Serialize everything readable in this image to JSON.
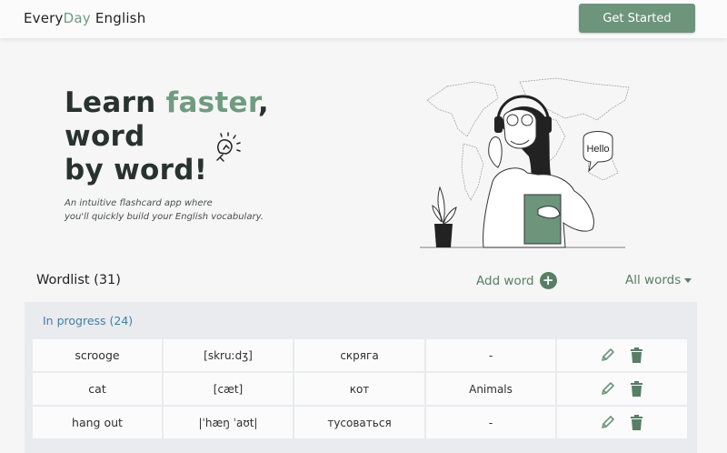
{
  "header": {
    "logo_part1": "Every",
    "logo_accent": "Day",
    "logo_part2": " English",
    "cta_label": "Get Started"
  },
  "hero": {
    "title_line1_a": "Learn ",
    "title_line1_accent": "faster",
    "title_line1_b": ",",
    "title_line2": "word",
    "title_line3": "by word!",
    "subtitle_line1": "An intuitive flashcard app where",
    "subtitle_line2": "you'll quickly build your English vocabulary.",
    "speech_bubble": "Hello"
  },
  "wordlist": {
    "title": "Wordlist (31)",
    "add_label": "Add word",
    "add_icon": "plus-circle-icon",
    "filter_label": "All words",
    "group_label": "In progress (24)",
    "rows": [
      {
        "word": "scrooge",
        "transcription": "[skruːdʒ]",
        "translation": "скряга",
        "category": "-"
      },
      {
        "word": "cat",
        "transcription": "[cæt]",
        "translation": "кот",
        "category": "Animals"
      },
      {
        "word": "hang out",
        "transcription": "|ˈhæŋ ˈaʊt|",
        "translation": "тусоваться",
        "category": "-"
      }
    ]
  },
  "colors": {
    "accent": "#6f9c80",
    "button": "#6c957b",
    "group_label": "#3f80a7",
    "icon": "#587e66"
  }
}
